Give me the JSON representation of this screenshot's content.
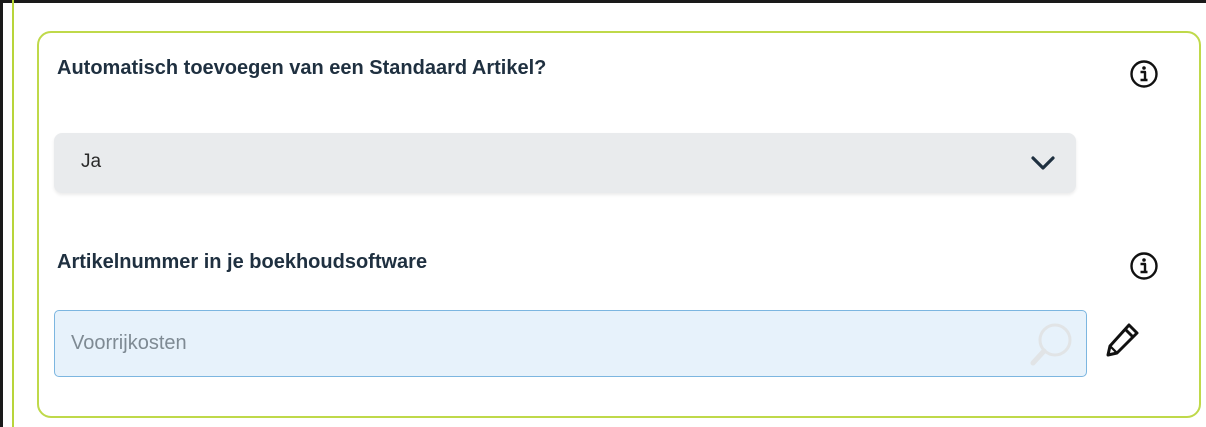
{
  "standard_article": {
    "question": "Automatisch toevoegen van een Standaard Artikel?",
    "info_icon": "info-circle-icon",
    "selected_value": "Ja",
    "dropdown_icon": "chevron-down-icon"
  },
  "article_number": {
    "label": "Artikelnummer in je boekhoudsoftware",
    "info_icon": "info-circle-icon",
    "placeholder": "Voorrijkosten",
    "search_icon": "search-icon",
    "edit_icon": "pencil-icon"
  },
  "colors": {
    "card_border": "#bfd94a",
    "label_text": "#1f3040",
    "select_background": "#e9ebed",
    "input_background": "#e7f2fb",
    "input_border": "#7cb6e0"
  }
}
